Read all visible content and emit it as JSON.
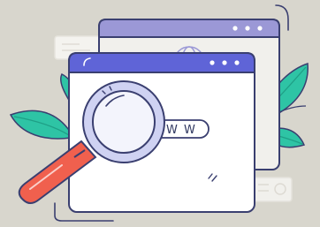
{
  "illustration": {
    "search_text": "W W W",
    "colors": {
      "background": "#d8d6cd",
      "window_fill": "#ffffff",
      "window_back_fill": "#f1f0ec",
      "titlebar_front": "#5f64d7",
      "titlebar_back": "#9b98d6",
      "outline": "#3a3f70",
      "leaf": "#2ec4a5",
      "leaf_dark": "#1f9f86",
      "handle": "#f0604e",
      "lens_ring": "#cfd2f2",
      "cursor": "#f5b878"
    },
    "icons": [
      "magnifier-icon",
      "globe-icon",
      "leaf-icon",
      "window-controls-icon"
    ]
  }
}
